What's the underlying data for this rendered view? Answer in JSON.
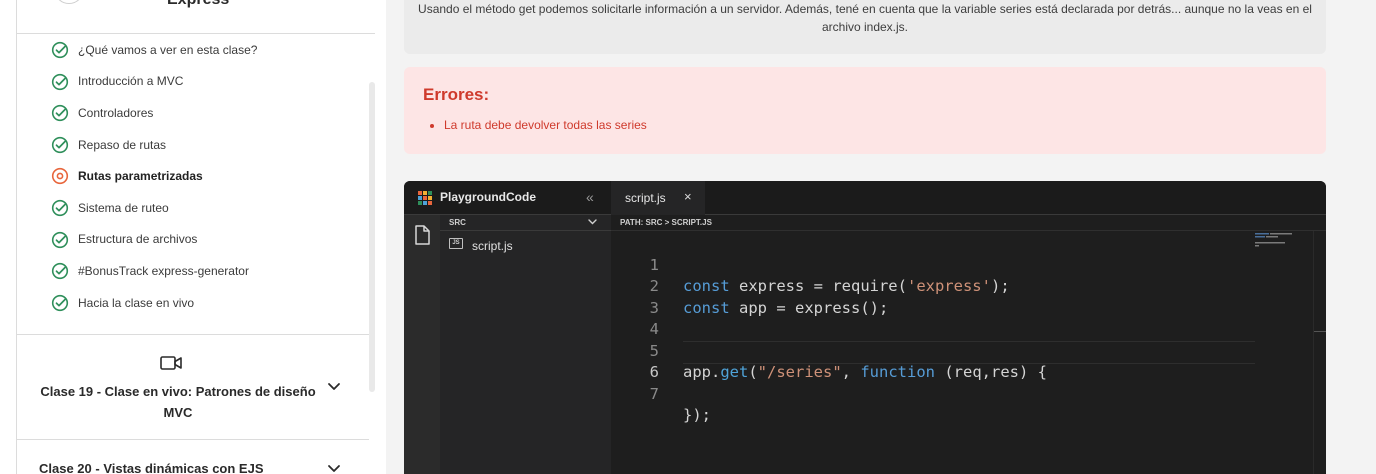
{
  "sidebar": {
    "module_title": "Express",
    "lessons": [
      {
        "label": "¿Qué vamos a ver en esta clase?",
        "status": "done"
      },
      {
        "label": "Introducción a MVC",
        "status": "done"
      },
      {
        "label": "Controladores",
        "status": "done"
      },
      {
        "label": "Repaso de rutas",
        "status": "done"
      },
      {
        "label": "Rutas parametrizadas",
        "status": "current"
      },
      {
        "label": "Sistema de ruteo",
        "status": "done"
      },
      {
        "label": "Estructura de archivos",
        "status": "done"
      },
      {
        "label": "#BonusTrack express-generator",
        "status": "done"
      },
      {
        "label": "Hacia la clase en vivo",
        "status": "done"
      }
    ],
    "clase19": "Clase 19 - Clase en vivo: Patrones de diseño MVC",
    "clase20": "Clase 20 - Vistas dinámicas con EJS"
  },
  "instructions": {
    "text": "Usando el método get podemos solicitarle información a un servidor. Además, tené en cuenta que la variable series está declarada por detrás... aunque no la veas en el archivo index.js."
  },
  "errors": {
    "title": "Errores:",
    "items": [
      "La ruta debe devolver todas las series"
    ]
  },
  "playground": {
    "title": "PlaygroundCode",
    "collapse_glyph": "«",
    "tab_label": "script.js",
    "tab_close": "×",
    "explorer_folder": "SRC",
    "file_badge": "JS",
    "file_name": "script.js",
    "path": "PATH: SRC > SCRIPT.JS",
    "line_numbers": [
      "1",
      "2",
      "3",
      "4",
      "5",
      "6",
      "7"
    ],
    "code_lines": [
      "const express = require('express');",
      "const app = express();",
      "",
      "",
      "app.get(\"/series\", function (req,res) {",
      "",
      "});"
    ],
    "current_line": 6
  },
  "colors": {
    "success": "#2f8f5b",
    "current": "#e8663d",
    "error": "#cf3a2c",
    "error_bg": "#fde5e5"
  }
}
